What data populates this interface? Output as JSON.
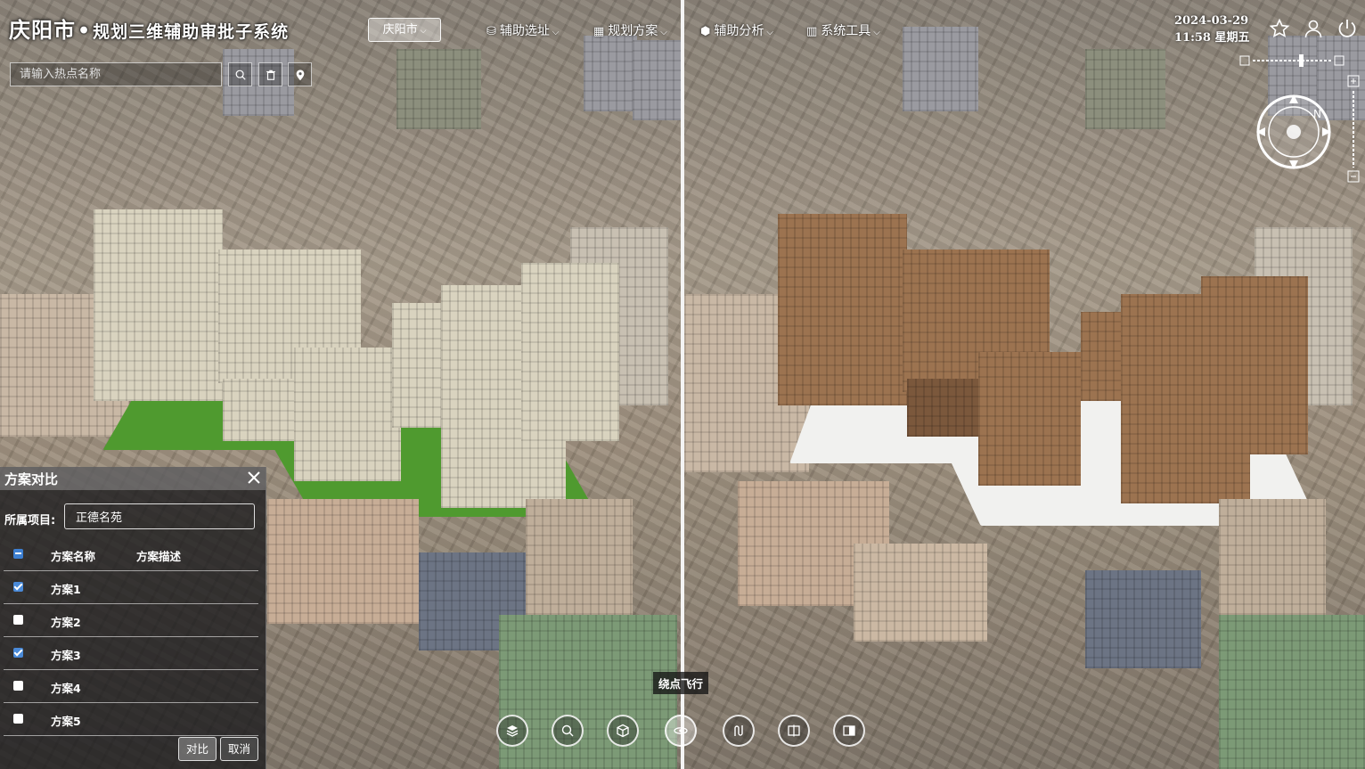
{
  "header": {
    "city": "庆阳市",
    "separator": "•",
    "system_title": "规划三维辅助审批子系统",
    "city_select": "庆阳市",
    "menu": [
      {
        "label": "辅助选址",
        "icon": "location-cubes-icon"
      },
      {
        "label": "规划方案",
        "icon": "building-icon"
      },
      {
        "label": "辅助分析",
        "icon": "cube-icon"
      },
      {
        "label": "系统工具",
        "icon": "toolbox-icon"
      }
    ],
    "date": "2024-03-29",
    "time_weekday": "11:58 星期五"
  },
  "search": {
    "placeholder": "请输入热点名称"
  },
  "panel": {
    "title": "方案对比",
    "project_label": "所属项目:",
    "project_value": "正德名苑",
    "columns": [
      "方案名称",
      "方案描述"
    ],
    "rows": [
      {
        "name": "方案1",
        "desc": "",
        "checked": true
      },
      {
        "name": "方案2",
        "desc": "",
        "checked": false
      },
      {
        "name": "方案3",
        "desc": "",
        "checked": true
      },
      {
        "name": "方案4",
        "desc": "",
        "checked": false
      },
      {
        "name": "方案5",
        "desc": "",
        "checked": false
      }
    ],
    "confirm": "对比",
    "cancel": "取消"
  },
  "toolbar": {
    "tooltip": "绕点飞行",
    "items": [
      "layers-icon",
      "search-icon",
      "box-icon",
      "orbit-icon",
      "route-icon",
      "split-icon",
      "compare-icon"
    ]
  },
  "colors": {
    "checkbox_checked": "#4a8ad8",
    "divider": "#f4f4f4",
    "scheme1_facade": "#d9d3bf",
    "scheme3_facade": "#9c7350"
  }
}
